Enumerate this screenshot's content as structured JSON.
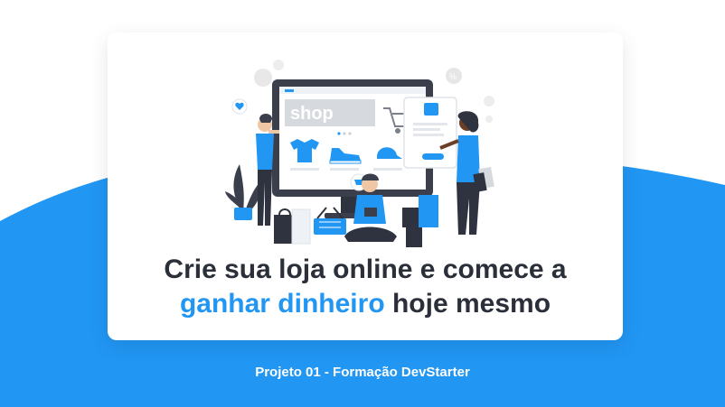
{
  "illustration": {
    "screen_text": "shop"
  },
  "headline": {
    "line1": "Crie sua loja online e comece a",
    "line2_highlight": "ganhar dinheiro",
    "line2_rest": " hoje mesmo"
  },
  "footer": {
    "text": "Projeto 01 - Formação DevStarter"
  },
  "colors": {
    "accent": "#2196f3",
    "heading": "#2b2f3a",
    "background_wave": "#2196f3"
  },
  "icons": [
    "shop-screen",
    "shopping-cart-icon",
    "tshirt-icon",
    "sneaker-icon",
    "cap-icon",
    "basket-icon",
    "shopping-bag-icon",
    "plant-icon",
    "heart-icon",
    "coin-icon",
    "percent-tag-icon"
  ]
}
